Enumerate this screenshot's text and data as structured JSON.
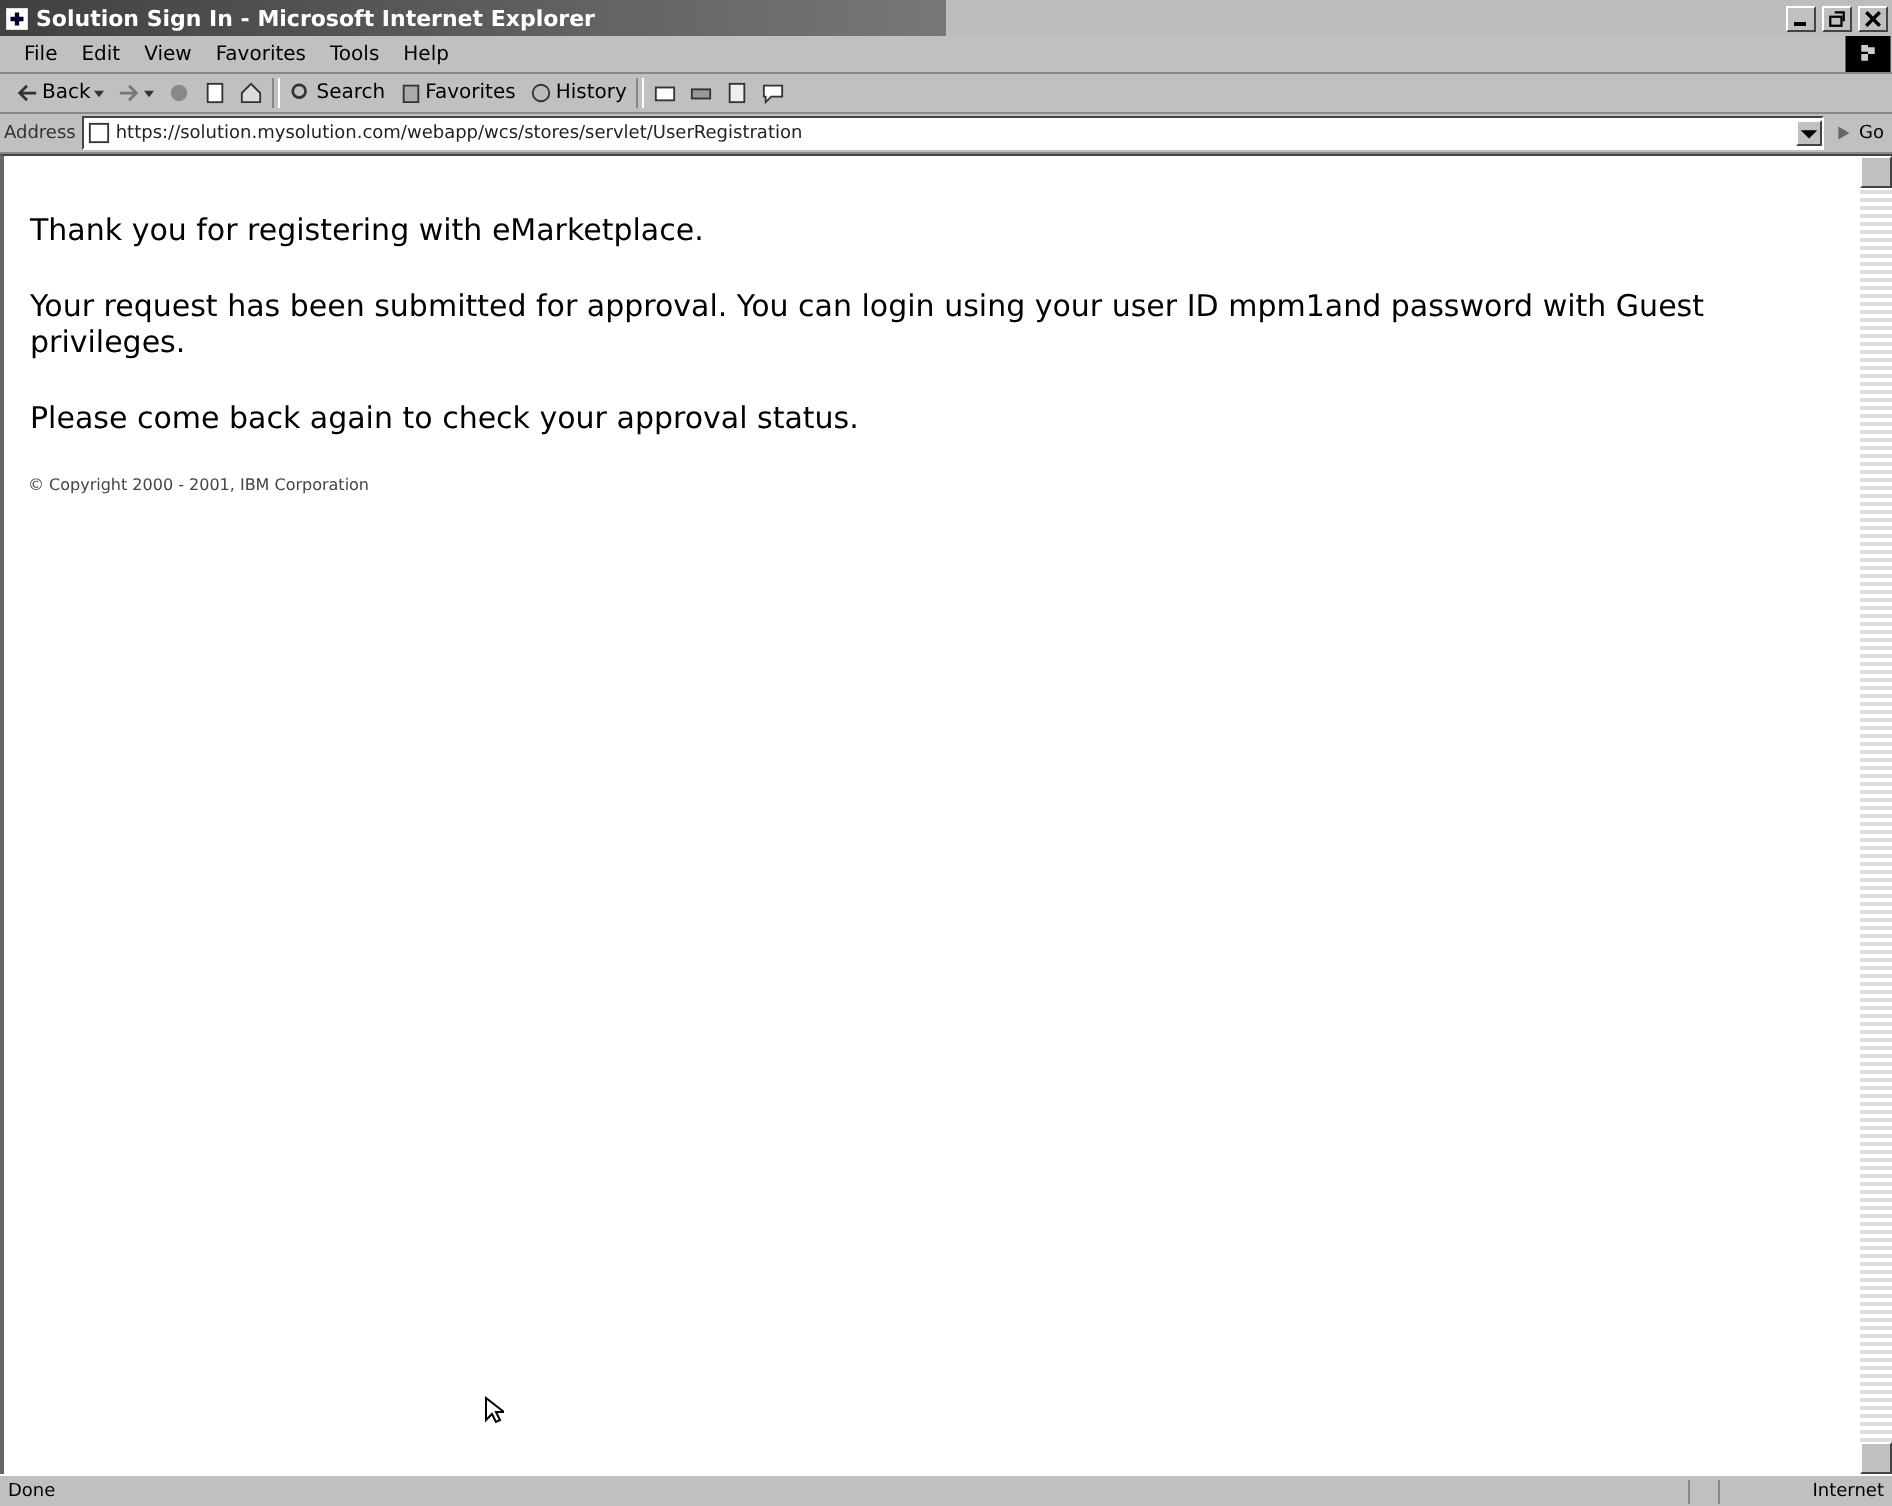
{
  "window": {
    "title": "Solution Sign In - Microsoft Internet Explorer"
  },
  "menu": [
    "File",
    "Edit",
    "View",
    "Favorites",
    "Tools",
    "Help"
  ],
  "toolbar": [
    {
      "kind": "back",
      "label": "Back"
    },
    {
      "kind": "forward"
    },
    {
      "kind": "stop"
    },
    {
      "kind": "refresh"
    },
    {
      "kind": "home"
    },
    {
      "kind": "search",
      "label": "Search"
    },
    {
      "kind": "favorites",
      "label": "Favorites"
    },
    {
      "kind": "history",
      "label": "History"
    },
    {
      "kind": "mail"
    },
    {
      "kind": "print"
    },
    {
      "kind": "edit"
    },
    {
      "kind": "discuss"
    }
  ],
  "address": {
    "label": "Address",
    "value": "https://solution.mysolution.com/webapp/wcs/stores/servlet/UserRegistration",
    "go": "Go"
  },
  "page": {
    "paragraphs": [
      "Thank you for registering with eMarketplace.",
      "Your request has been submitted for approval. You can login using your user ID mpm1and password with Guest privileges.",
      "Please come back again to check your approval status."
    ],
    "copyright": "© Copyright 2000 - 2001, IBM Corporation"
  },
  "status_bar": {
    "text": "Done",
    "zone": "Internet"
  }
}
